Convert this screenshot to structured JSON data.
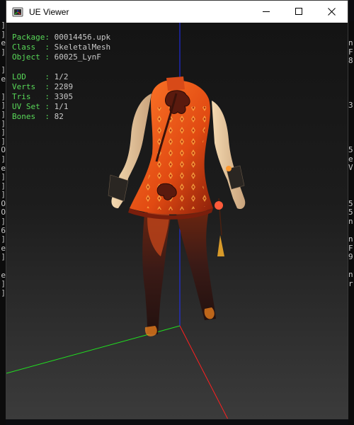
{
  "window": {
    "title": "UE Viewer",
    "controls": {
      "minimize": "—",
      "maximize": "☐",
      "close": "✕"
    }
  },
  "info": {
    "package": {
      "label": "Package:",
      "value": "00014456.upk"
    },
    "class": {
      "label": "Class  :",
      "value": "SkeletalMesh"
    },
    "object": {
      "label": "Object :",
      "value": "60025_LynF"
    },
    "lod": {
      "label": "LOD    :",
      "value": "1/2"
    },
    "verts": {
      "label": "Verts  :",
      "value": "2289"
    },
    "tris": {
      "label": "Tris   :",
      "value": "3305"
    },
    "uvset": {
      "label": "UV Set :",
      "value": "1/1"
    },
    "bones": {
      "label": "Bones  :",
      "value": "82"
    }
  },
  "background_console": {
    "left": [
      "]",
      "]",
      "e",
      "]",
      "",
      "]",
      "e",
      "",
      "]",
      "]",
      "]",
      "]",
      "]",
      "]",
      "O",
      "]",
      "e",
      "]",
      "]",
      "]",
      "O",
      "O",
      "]",
      "6",
      "]",
      "e",
      "]",
      "",
      "e",
      "]",
      "]"
    ],
    "right": [
      "n",
      "F",
      "8",
      "",
      "",
      "",
      "",
      "3",
      "",
      "",
      "",
      "",
      "5",
      "e",
      "V",
      "",
      "",
      "",
      "5",
      "5",
      "n",
      "",
      "n",
      "F",
      "9",
      "",
      "n",
      "r",
      "",
      "",
      ""
    ]
  },
  "colors": {
    "axis_x": "#ff2020",
    "axis_y": "#20e020",
    "axis_z": "#2030ff",
    "info_label": "#58d858",
    "info_value": "#c9c9c9"
  },
  "icons": {
    "app": "ue-viewer-app-icon",
    "model": "skeletal-mesh-render"
  }
}
